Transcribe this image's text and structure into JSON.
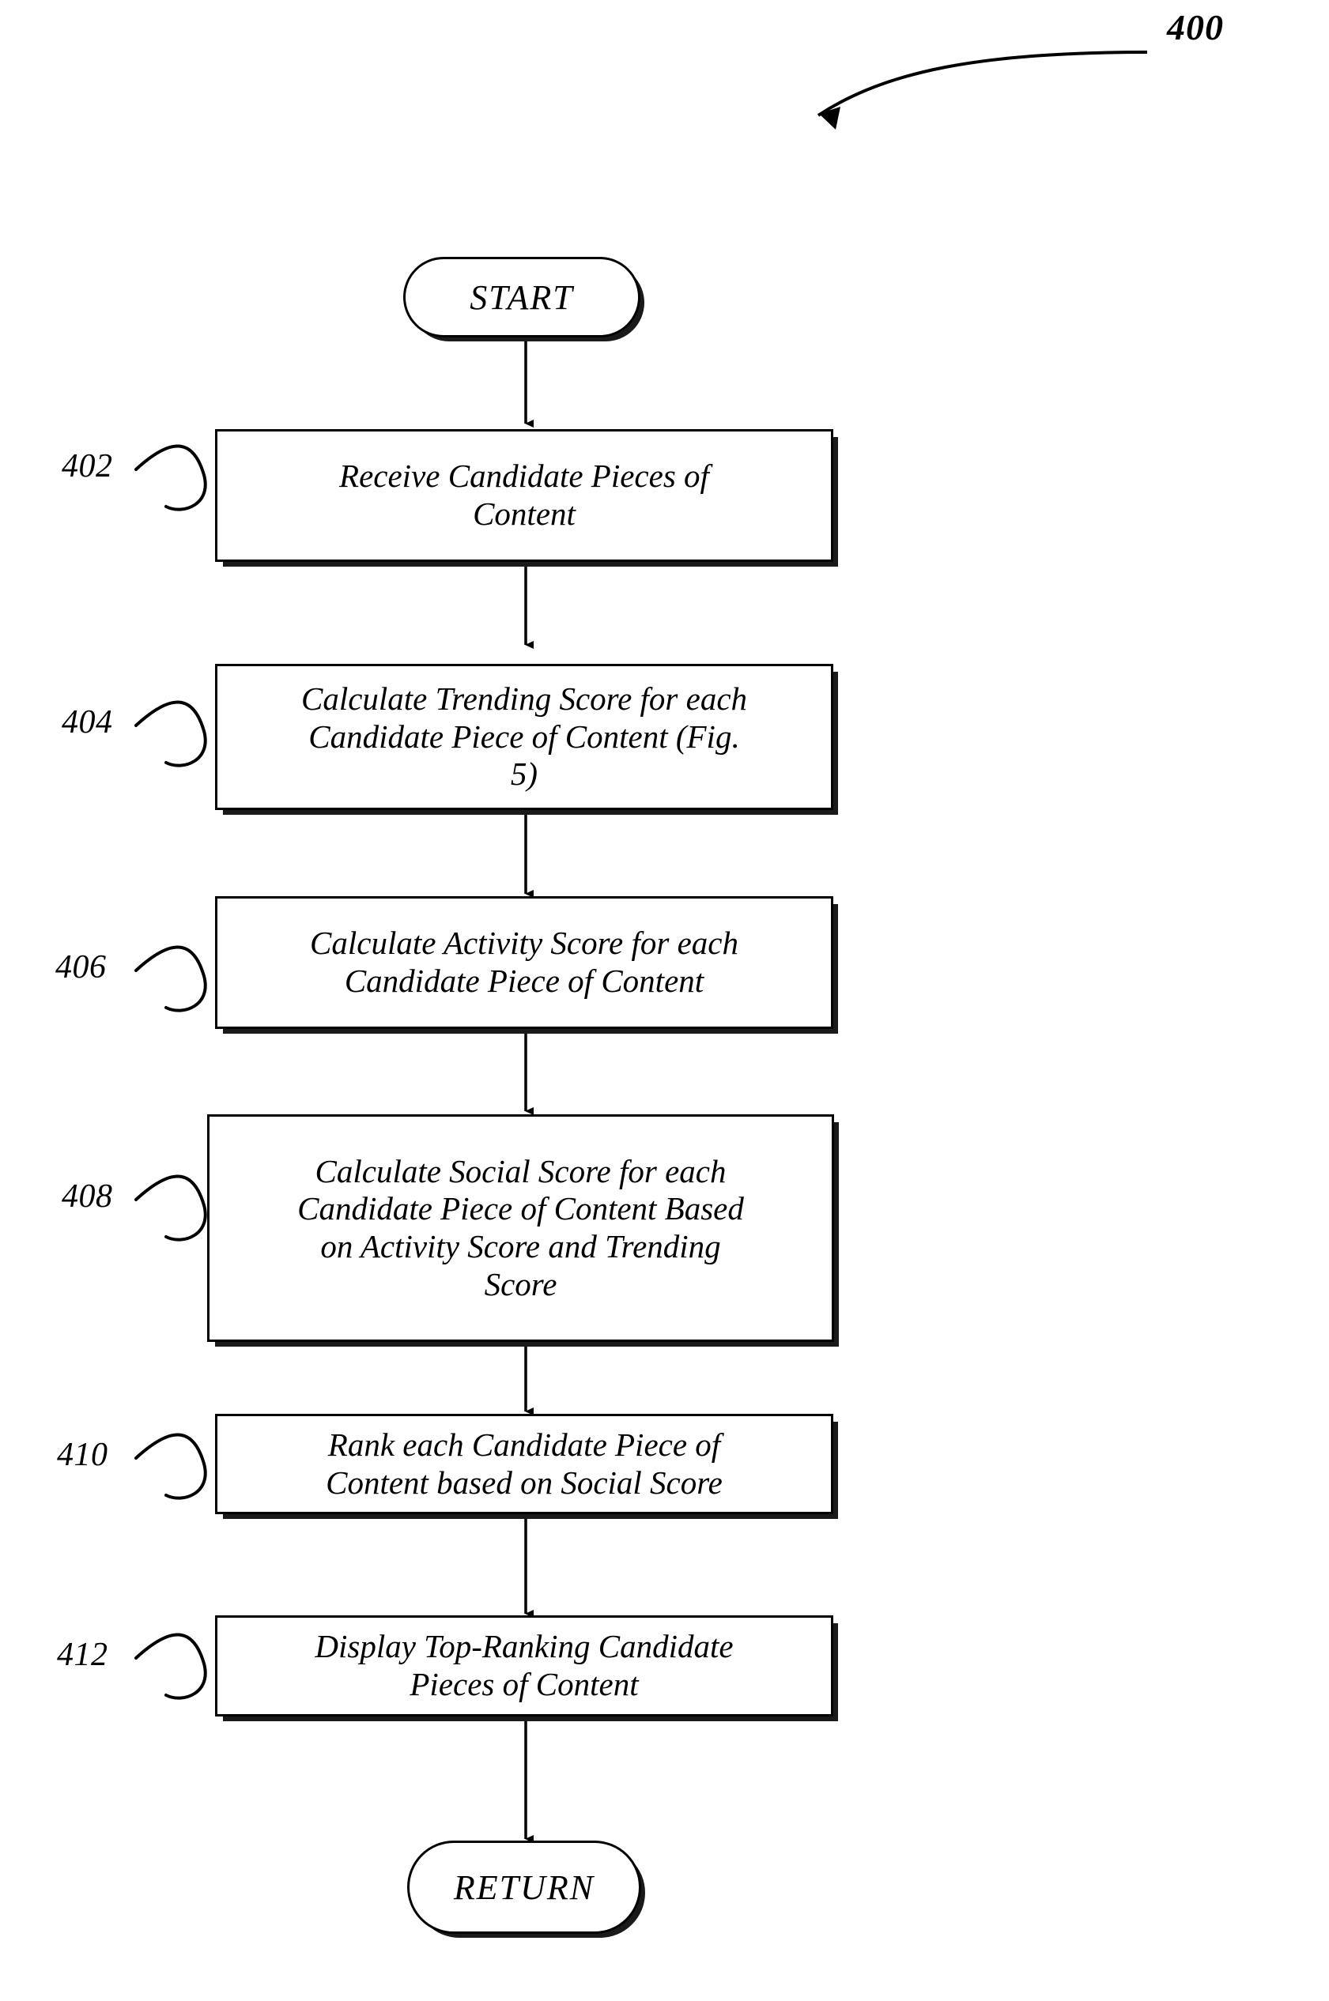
{
  "figure": {
    "number": "400",
    "type": "patent-flowchart"
  },
  "chart_data": {
    "type": "diagram",
    "title": "400",
    "nodes": [
      {
        "id": "start",
        "kind": "terminal",
        "label": "START",
        "ref": null
      },
      {
        "id": "s402",
        "kind": "process",
        "label": "Receive Candidate Pieces of\nContent",
        "ref": "402"
      },
      {
        "id": "s404",
        "kind": "process",
        "label": "Calculate Trending Score for each\nCandidate Piece of Content (Fig.\n5)",
        "ref": "404"
      },
      {
        "id": "s406",
        "kind": "process",
        "label": "Calculate Activity Score for each\nCandidate Piece of Content",
        "ref": "406"
      },
      {
        "id": "s408",
        "kind": "process",
        "label": "Calculate Social Score for each\nCandidate Piece of Content Based\non Activity Score and Trending\nScore",
        "ref": "408"
      },
      {
        "id": "s410",
        "kind": "process",
        "label": "Rank each Candidate Piece of\nContent based on Social Score",
        "ref": "410"
      },
      {
        "id": "s412",
        "kind": "process",
        "label": "Display Top-Ranking Candidate\nPieces of Content",
        "ref": "412"
      },
      {
        "id": "return",
        "kind": "terminal",
        "label": "RETURN",
        "ref": null
      }
    ],
    "edges": [
      {
        "from": "start",
        "to": "s402"
      },
      {
        "from": "s402",
        "to": "s404"
      },
      {
        "from": "s404",
        "to": "s406"
      },
      {
        "from": "s406",
        "to": "s408"
      },
      {
        "from": "s408",
        "to": "s410"
      },
      {
        "from": "s410",
        "to": "s412"
      },
      {
        "from": "s412",
        "to": "return"
      }
    ]
  },
  "terminals": {
    "start": {
      "label": "START"
    },
    "end": {
      "label": "RETURN"
    }
  },
  "steps": [
    {
      "ref": "402",
      "text": "Receive Candidate Pieces of\nContent"
    },
    {
      "ref": "404",
      "text": "Calculate Trending Score for each\nCandidate Piece of Content (Fig.\n5)"
    },
    {
      "ref": "406",
      "text": "Calculate Activity Score for each\nCandidate Piece of Content"
    },
    {
      "ref": "408",
      "text": "Calculate Social Score for each\nCandidate Piece of Content Based\non Activity Score and Trending\nScore"
    },
    {
      "ref": "410",
      "text": "Rank each Candidate Piece of\nContent based on Social Score"
    },
    {
      "ref": "412",
      "text": "Display Top-Ranking Candidate\nPieces of Content"
    }
  ],
  "colors": {
    "ink": "#000000",
    "paper": "#ffffff",
    "shadow": "#1a1a1a"
  }
}
